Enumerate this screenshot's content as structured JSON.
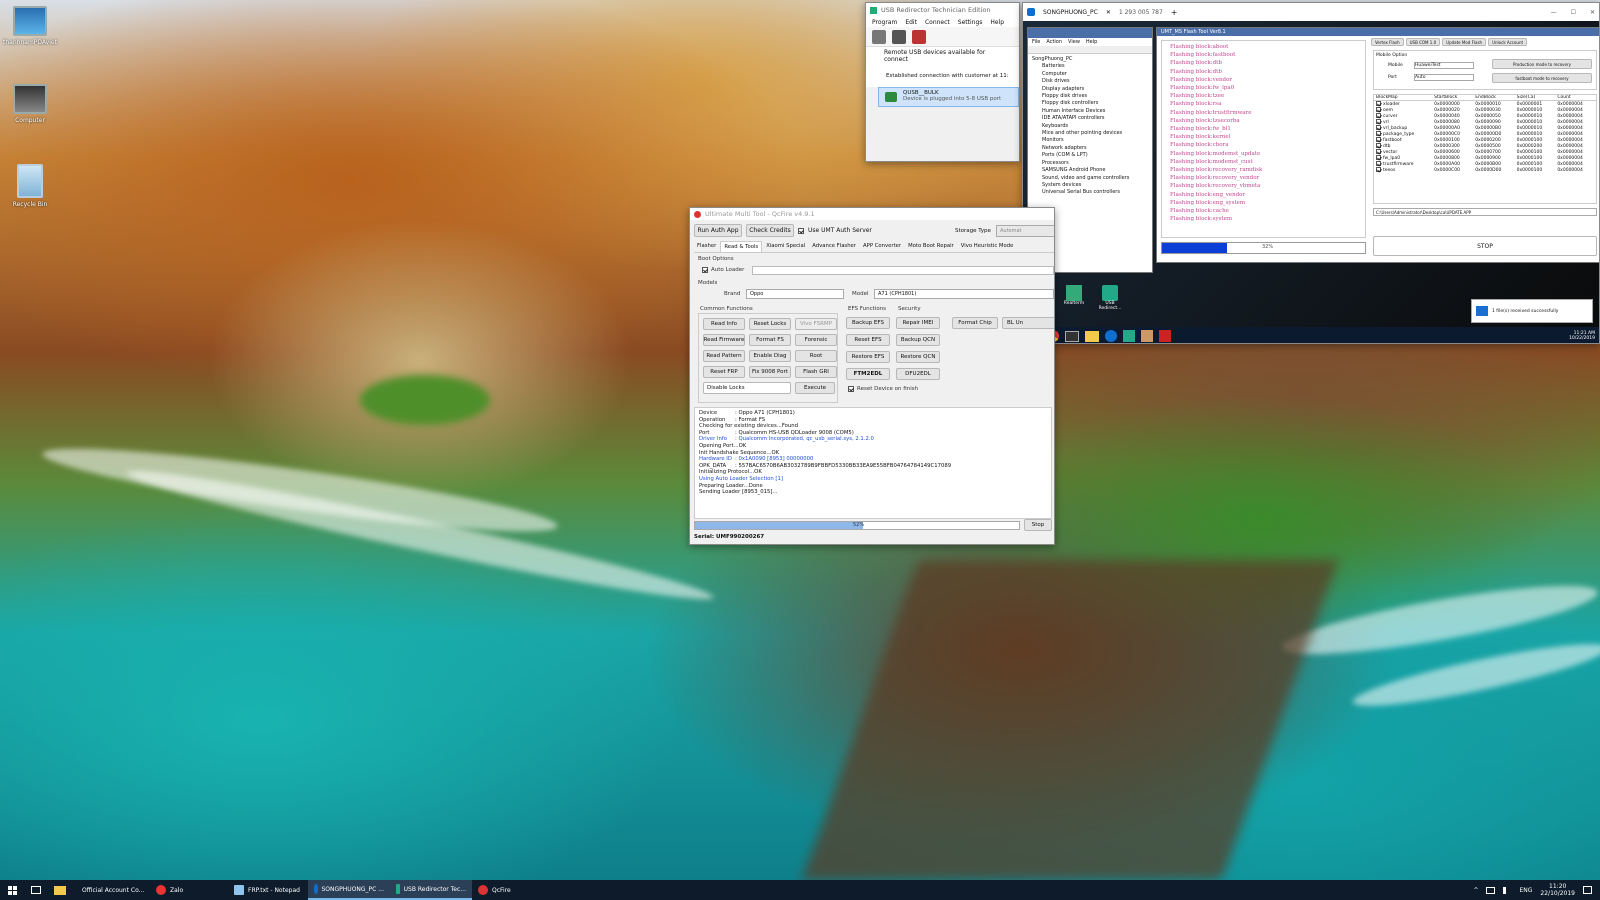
{
  "desktop": {
    "icons": [
      {
        "label": "thanhnamPDAviet"
      },
      {
        "label": "Computer"
      },
      {
        "label": "Recycle Bin"
      }
    ]
  },
  "usb_redirector": {
    "title": "USB Redirector Technician Edition",
    "menu": [
      "Program",
      "Edit",
      "Connect",
      "Settings",
      "Help"
    ],
    "header": "Remote USB devices available for connect",
    "connection": "Established connection with customer at 11:",
    "device_name": "QUSB__BULK",
    "device_desc": "Device is plugged into 5-8 USB port"
  },
  "remote": {
    "tab_label": "SONGPHUONG_PC",
    "tab_id": "1 293 005 787",
    "devmgr": {
      "menu": [
        "File",
        "Action",
        "View",
        "Help"
      ],
      "root": "SongPhuong_PC",
      "items": [
        "Batteries",
        "Computer",
        "Disk drives",
        "Display adapters",
        "Floppy disk drives",
        "Floppy disk controllers",
        "Human Interface Devices",
        "IDE ATA/ATAPI controllers",
        "Keyboards",
        "Mice and other pointing devices",
        "Monitors",
        "Network adapters",
        "Ports (COM & LPT)",
        "Processors",
        "SAMSUNG Android Phone",
        "Sound, video and game controllers",
        "System devices",
        "Universal Serial Bus controllers"
      ]
    },
    "flash_tool": {
      "title": "UMT_MS Flash Tool Ver8.1",
      "log": [
        "Flashing block:aboot",
        "Flashing block:fastboot",
        "Flashing block:dtb",
        "Flashing block:dtb",
        "Flashing block:vendor",
        "Flashing block:fw_lpa0",
        "Flashing block:tzee",
        "Flashing block:rsa",
        "Flashing block:trustfirmware",
        "Flashing block:tzsecorba",
        "Flashing block:fw_bl1",
        "Flashing block:kernel",
        "Flashing block:cbora",
        "Flashing block:modemst_update",
        "Flashing block:modemst_cust",
        "Flashing block:recovery_ramdisk",
        "Flashing block:recovery_vendor",
        "Flashing block:recovery_vbmeta",
        "Flashing block:eng_vendor",
        "Flashing block:eng_system",
        "Flashing block:cache",
        "Flashing block:system"
      ],
      "percent": "32%",
      "progress_fraction": 0.32,
      "stop": "STOP",
      "tabs": [
        "Vertex Flash",
        "USB COM 1.0",
        "Update Mod Flash",
        "Unlock Account"
      ],
      "mobile_label": "Mobile Option",
      "mobile": "Mobile",
      "mobile_val": "HuaweiTest",
      "port": "Port",
      "port_val": "Auto",
      "btn1": "Production mode to recovery",
      "btn2": "fastboot mode to recovery",
      "path": "C:\\Users\\Administrator\\Desktop\\ca\\UPDATE.APP",
      "table_headers": [
        "BlockMap",
        "StartBlock",
        "EndBlock",
        "Size(Ca)",
        "Count"
      ],
      "table_rows": [
        [
          "xloader",
          "0x0000000",
          "0x0000010",
          "0x0000001",
          "0x0000004"
        ],
        [
          "oem",
          "0x0000020",
          "0x0000030",
          "0x0000010",
          "0x0000004"
        ],
        [
          "curver",
          "0x0000040",
          "0x0000050",
          "0x0000010",
          "0x0000004"
        ],
        [
          "vrl",
          "0x0000080",
          "0x0000090",
          "0x0000010",
          "0x0000004"
        ],
        [
          "vrl_backup",
          "0x00000A0",
          "0x00000B0",
          "0x0000010",
          "0x0000004"
        ],
        [
          "package_type",
          "0x00000C0",
          "0x00000D0",
          "0x0000010",
          "0x0000004"
        ],
        [
          "fastboot",
          "0x0000100",
          "0x0000200",
          "0x0000100",
          "0x0000004"
        ],
        [
          "dtb",
          "0x0000300",
          "0x0000500",
          "0x0000200",
          "0x0000004"
        ],
        [
          "vector",
          "0x0000600",
          "0x0000700",
          "0x0000100",
          "0x0000004"
        ],
        [
          "fw_lpa0",
          "0x0000800",
          "0x0000900",
          "0x0000100",
          "0x0000004"
        ],
        [
          "trustfirmware",
          "0x0000A00",
          "0x0000B00",
          "0x0000100",
          "0x0000004"
        ],
        [
          "teeos",
          "0x0000C00",
          "0x0000D00",
          "0x0000100",
          "0x0000004"
        ]
      ]
    },
    "shortcuts": [
      "iTunes",
      "Realterm",
      "USB Redirect..."
    ],
    "notif": "1 file(s) received successfully",
    "clock_time": "11:21 AM",
    "clock_date": "10/22/2019"
  },
  "umt": {
    "title": "Ultimate Multi Tool - QcFire v4.9.1",
    "run_auth": "Run Auth App",
    "check_credits": "Check Credits",
    "use_server": "Use UMT Auth Server",
    "storage_type": "Storage Type",
    "storage_val": "Automat",
    "tabs": [
      "Flasher",
      "Read & Tools",
      "Xiaomi Special",
      "Advance Flasher",
      "APP Converter",
      "Moto Boot Repair",
      "Vivo Heuristic Mode"
    ],
    "boot_options": "Boot Options",
    "auto_loader": "Auto Loader",
    "models": "Models",
    "brand_label": "Brand",
    "brand_val": "Oppo",
    "model_label": "Model",
    "model_val": "A71 (CPH1801)",
    "common_functions": "Common Functions",
    "efs_functions": "EFS Functions",
    "security": "Security",
    "common_buttons": [
      "Read Info",
      "Reset Locks",
      "Vivo FSRMP",
      "Read Firmware",
      "Format FS",
      "Forensic",
      "Read Pattern",
      "Enable Diag",
      "Root",
      "Reset FRP",
      "Fix 9008 Port",
      "Flash GRI"
    ],
    "disable_locks": "Disable Locks",
    "execute": "Execute",
    "efs_buttons": [
      "Backup EFS",
      "Reset EFS",
      "Restore EFS"
    ],
    "sec_buttons": [
      "Repair IMEI",
      "Backup QCN",
      "Restore QCN"
    ],
    "format_chip": "Format Chip",
    "bl_unlock": "BL Un",
    "ftm2edl": "FTM2EDL",
    "dfu2edl": "DFU2EDL",
    "reset_finish": "Reset Device on finish",
    "log": [
      {
        "k": "Device",
        "v": ": Oppo A71 (CPH1801)",
        "c": ""
      },
      {
        "k": "Operation",
        "v": ": Format FS",
        "c": ""
      },
      {
        "k": "Checking for existing devices...Found",
        "v": "",
        "c": ""
      },
      {
        "k": "Port",
        "v": ": Qualcomm HS-USB QDLoader 9008 (COM5)",
        "c": ""
      },
      {
        "k": "Driver Info",
        "v": ": Qualcomm Incorporated, qc_usb_serial.sys, 2.1.2.0",
        "c": "blue"
      },
      {
        "k": "Opening Port...OK",
        "v": "",
        "c": ""
      },
      {
        "k": "Init Handshake Sequence...OK",
        "v": "",
        "c": ""
      },
      {
        "k": "Hardware ID",
        "v": ": 0x1A0090 [8953] 00000000",
        "c": "blue"
      },
      {
        "k": "OPK_DATA",
        "v": ": 557BAC6570B6AB3032789B9FBBFD5330BB33EA9E55BFB04764784149C17089",
        "c": ""
      },
      {
        "k": "Initializing Protocol...OK",
        "v": "",
        "c": ""
      },
      {
        "k": "Using Auto Loader Selection [1]",
        "v": "",
        "c": "blue"
      },
      {
        "k": "Preparing Loader...Done",
        "v": "",
        "c": ""
      },
      {
        "k": "Sending Loader [8953_015]...",
        "v": "",
        "c": ""
      }
    ],
    "progress_text": "52%",
    "progress_fraction": 0.52,
    "stop": "Stop",
    "serial": "Serial: UMF990200267"
  },
  "taskbar": {
    "items": [
      "Official Account Co...",
      "Zalo",
      "FRP.txt - Notepad",
      "SONGPHUONG_PC ...",
      "USB Redirector Tec...",
      "QcFire"
    ],
    "lang": "ENG",
    "time": "11:20",
    "date": "22/10/2019"
  }
}
